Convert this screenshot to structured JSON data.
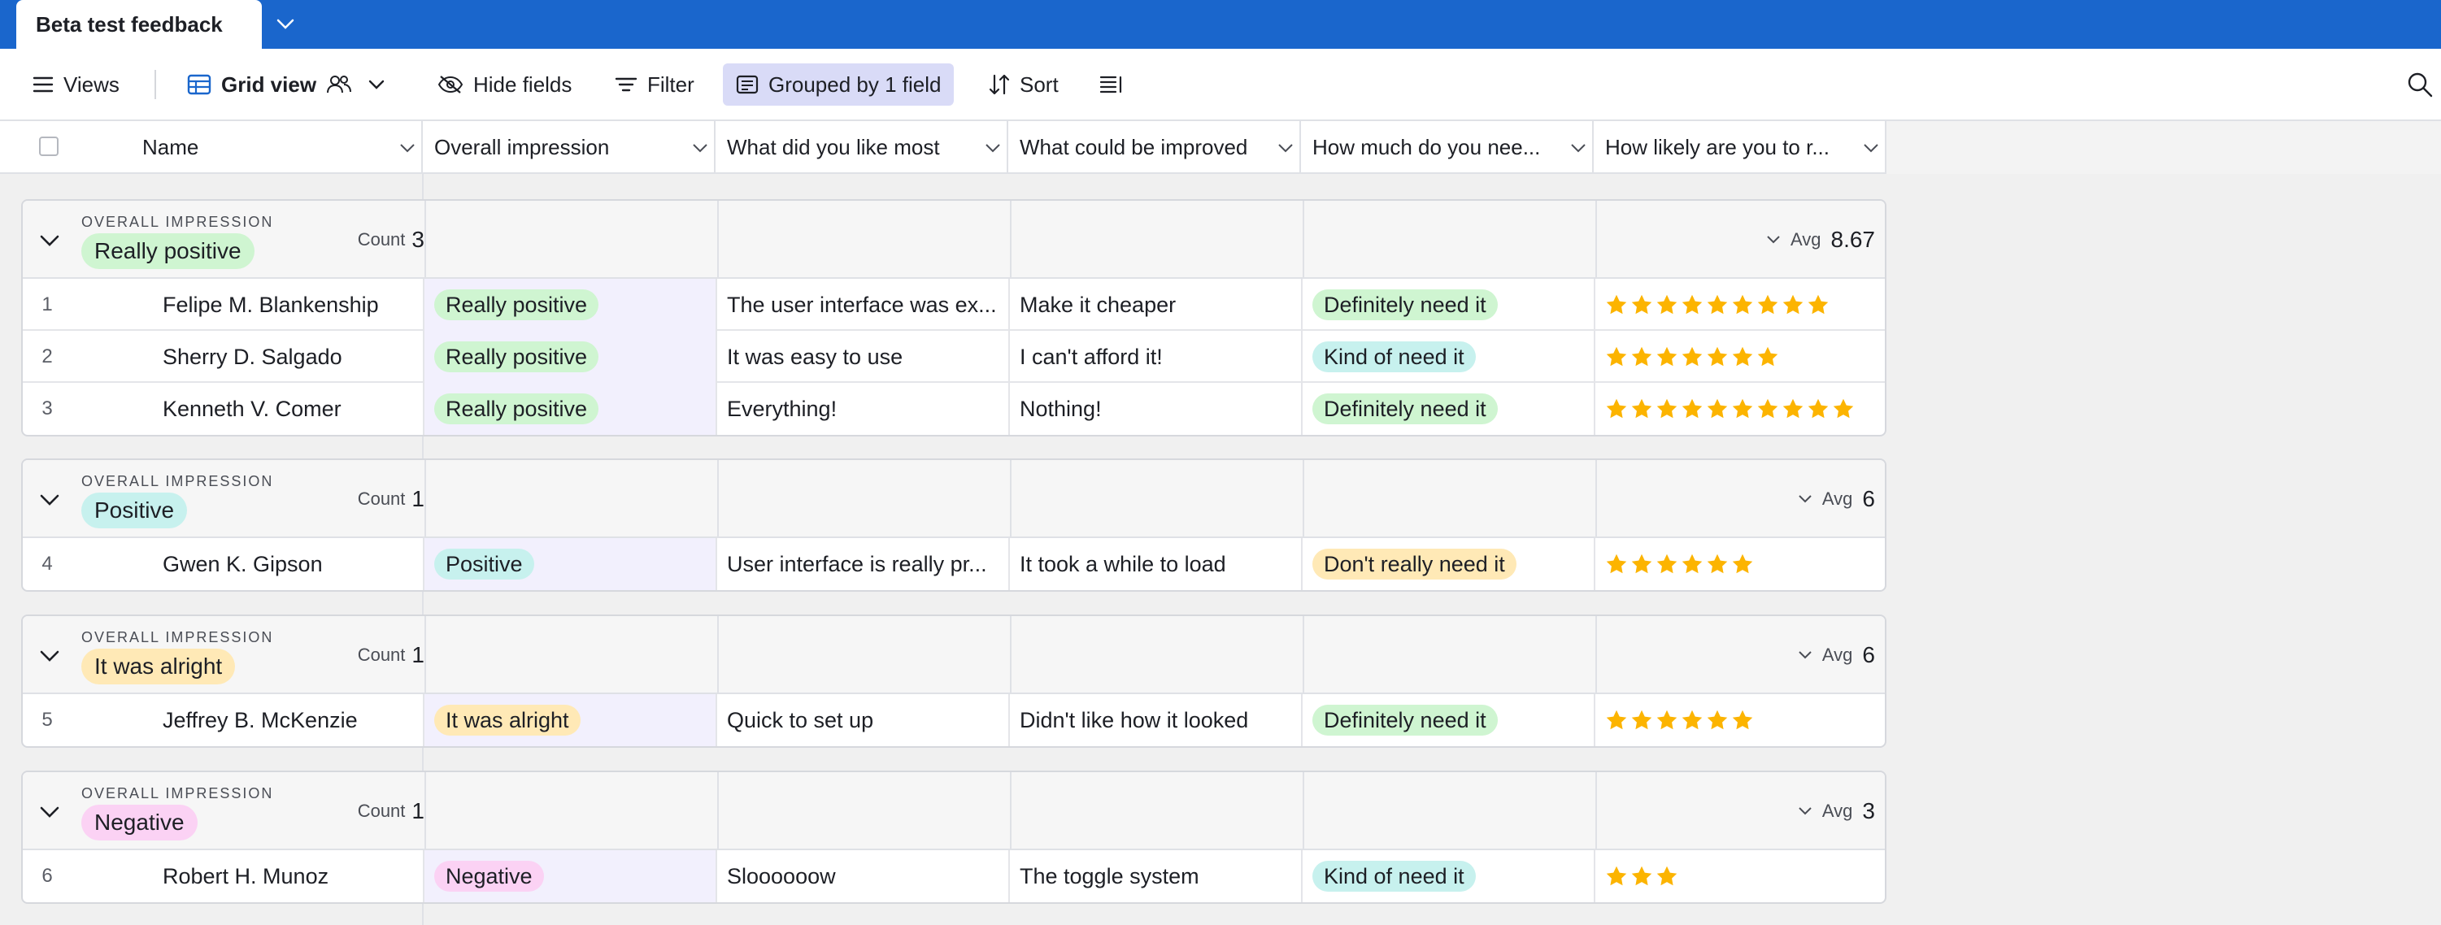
{
  "tab": {
    "title": "Beta test feedback"
  },
  "toolbar": {
    "views": "Views",
    "grid_view": "Grid view",
    "hide_fields": "Hide fields",
    "filter": "Filter",
    "grouped": "Grouped by 1 field",
    "sort": "Sort"
  },
  "columns": {
    "name": "Name",
    "impression": "Overall impression",
    "liked": "What did you like most",
    "improved": "What could be improved",
    "need": "How much do you nee...",
    "likely": "How likely are you to r..."
  },
  "colors": {
    "Really positive": "#cff5d1",
    "Positive": "#c7f1ee",
    "It was alright": "#ffe9b6",
    "Negative": "#fbd2f4",
    "Definitely need it": "#cff5d1",
    "Kind of need it": "#c7f1ee",
    "Don't really need it": "#ffe9b6",
    "star": "#fcb400"
  },
  "groups": [
    {
      "field_label": "OVERALL IMPRESSION",
      "value": "Really positive",
      "count_label": "Count",
      "count": "3",
      "avg_label": "Avg",
      "avg": "8.67",
      "rows": [
        {
          "num": "1",
          "name": "Felipe M. Blankenship",
          "impression": "Really positive",
          "liked": "The user interface was ex...",
          "improved": "Make it cheaper",
          "need": "Definitely need it",
          "rating": 9
        },
        {
          "num": "2",
          "name": "Sherry D. Salgado",
          "impression": "Really positive",
          "liked": "It was easy to use",
          "improved": "I can't afford it!",
          "need": "Kind of need it",
          "rating": 7
        },
        {
          "num": "3",
          "name": "Kenneth V. Comer",
          "impression": "Really positive",
          "liked": "Everything!",
          "improved": "Nothing!",
          "need": "Definitely need it",
          "rating": 10
        }
      ]
    },
    {
      "field_label": "OVERALL IMPRESSION",
      "value": "Positive",
      "count_label": "Count",
      "count": "1",
      "avg_label": "Avg",
      "avg": "6",
      "rows": [
        {
          "num": "4",
          "name": "Gwen K. Gipson",
          "impression": "Positive",
          "liked": "User interface is really pr...",
          "improved": "It took a while to load",
          "need": "Don't really need it",
          "rating": 6
        }
      ]
    },
    {
      "field_label": "OVERALL IMPRESSION",
      "value": "It was alright",
      "count_label": "Count",
      "count": "1",
      "avg_label": "Avg",
      "avg": "6",
      "rows": [
        {
          "num": "5",
          "name": "Jeffrey B. McKenzie",
          "impression": "It was alright",
          "liked": "Quick to set up",
          "improved": "Didn't like how it looked",
          "need": "Definitely need it",
          "rating": 6
        }
      ]
    },
    {
      "field_label": "OVERALL IMPRESSION",
      "value": "Negative",
      "count_label": "Count",
      "count": "1",
      "avg_label": "Avg",
      "avg": "3",
      "rows": [
        {
          "num": "6",
          "name": "Robert H. Munoz",
          "impression": "Negative",
          "liked": "Sloooooow",
          "improved": "The toggle system",
          "need": "Kind of need it",
          "rating": 3
        }
      ]
    }
  ]
}
